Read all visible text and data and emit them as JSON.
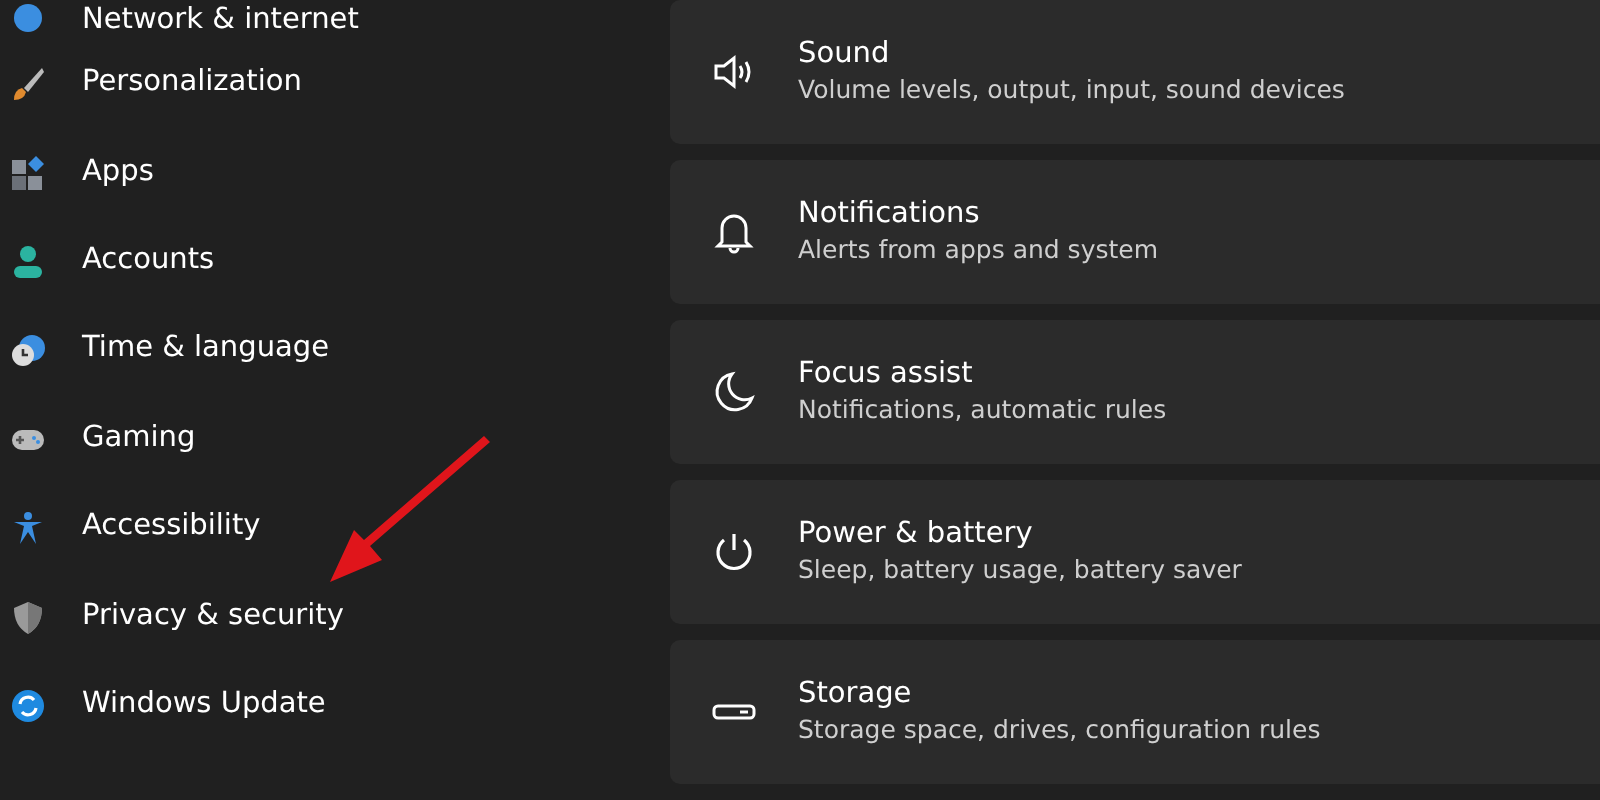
{
  "sidebar": {
    "items": [
      {
        "label": "Network & internet"
      },
      {
        "label": "Personalization"
      },
      {
        "label": "Apps"
      },
      {
        "label": "Accounts"
      },
      {
        "label": "Time & language"
      },
      {
        "label": "Gaming"
      },
      {
        "label": "Accessibility"
      },
      {
        "label": "Privacy & security"
      },
      {
        "label": "Windows Update"
      }
    ]
  },
  "settings": [
    {
      "title": "Sound",
      "description": "Volume levels, output, input, sound devices"
    },
    {
      "title": "Notifications",
      "description": "Alerts from apps and system"
    },
    {
      "title": "Focus assist",
      "description": "Notifications, automatic rules"
    },
    {
      "title": "Power & battery",
      "description": "Sleep, battery usage, battery saver"
    },
    {
      "title": "Storage",
      "description": "Storage space, drives, configuration rules"
    }
  ]
}
